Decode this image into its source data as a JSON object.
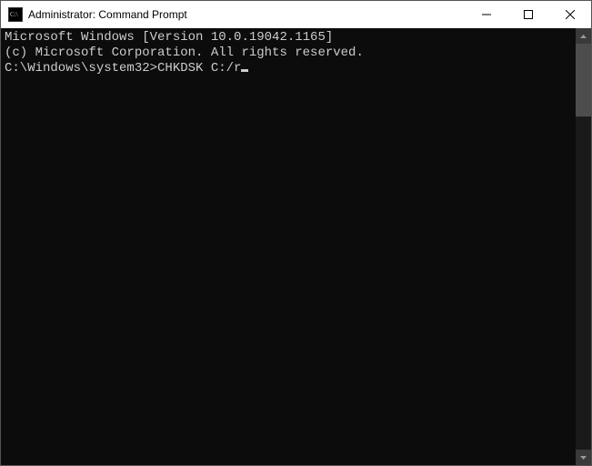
{
  "titlebar": {
    "icon_text": "C:\\",
    "title": "Administrator: Command Prompt"
  },
  "terminal": {
    "line1": "Microsoft Windows [Version 10.0.19042.1165]",
    "line2": "(c) Microsoft Corporation. All rights reserved.",
    "blank": "",
    "prompt": "C:\\Windows\\system32>",
    "command": "CHKDSK C:/r"
  }
}
